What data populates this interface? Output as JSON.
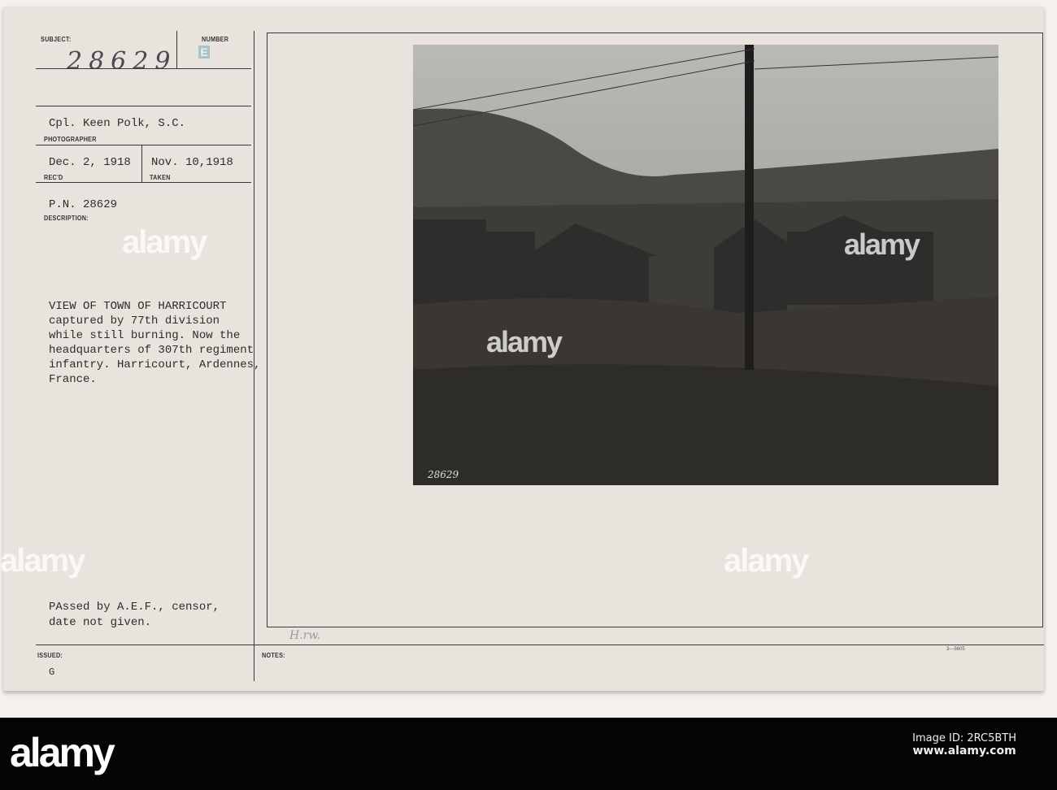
{
  "card": {
    "subject_label": "SUBJECT:",
    "subject_number": "28629",
    "number_label": "NUMBER",
    "number_stamp": "E",
    "photographer": "Cpl. Keen Polk, S.C.",
    "photographer_label": "PHOTOGRAPHER",
    "received": "Dec. 2, 1918",
    "received_label": "REC'D",
    "taken": "Nov. 10,1918",
    "taken_label": "TAKEN",
    "pn": "P.N. 28629",
    "description_label": "DESCRIPTION:",
    "description": "VIEW OF TOWN OF HARRICOURT\ncaptured by 77th division\nwhile still burning. Now the\nheadquarters of 307th regiment\ninfantry. Harricourt, Ardennes,\nFrance.",
    "censor": "PAssed by A.E.F., censor,\ndate not given.",
    "issued_label": "ISSUED:",
    "issued": "G",
    "notes_label": "NOTES:",
    "notes_handwriting": "H.rw.",
    "form_number": "3—5605",
    "photo_number": "28629"
  },
  "watermark": "alamy",
  "footer": {
    "logo": "alamy",
    "image_id": "Image ID: 2RC5BTH",
    "site": "www.alamy.com"
  }
}
